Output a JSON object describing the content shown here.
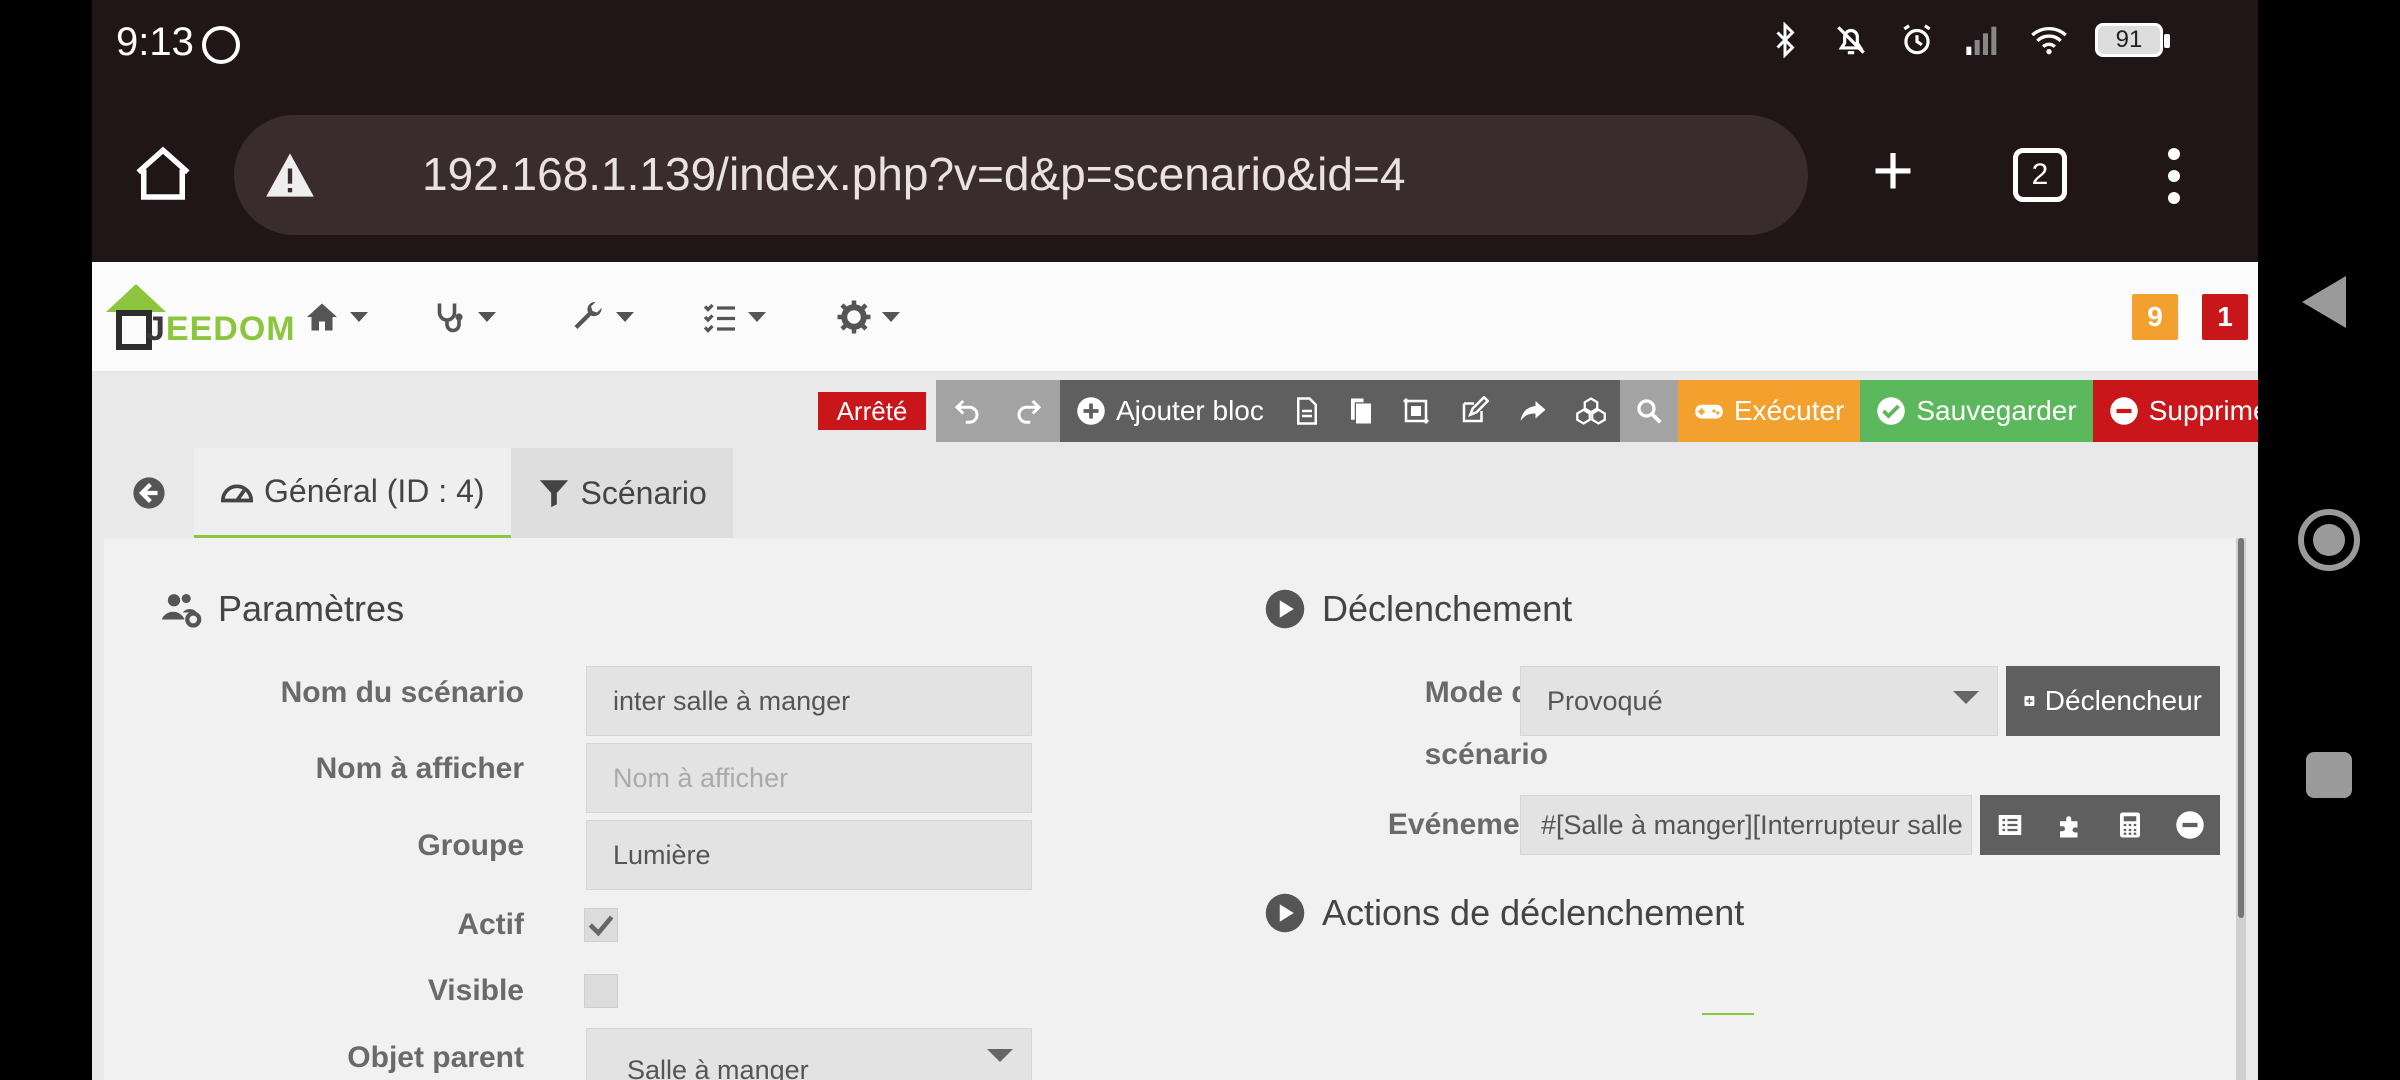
{
  "status_bar": {
    "time": "9:13",
    "battery": "91"
  },
  "browser": {
    "url": "192.168.1.139/index.php?v=d&p=scenario&id=4",
    "tab_count": "2"
  },
  "notifications": {
    "orange_count": "9",
    "red_count": "1"
  },
  "colors": {
    "accent_green": "#8cc63f",
    "danger_red": "#c9161b",
    "warning_orange": "#f2a12e",
    "success_green": "#5cb85c"
  },
  "toolbar": {
    "state": "Arrêté",
    "add_block": "Ajouter bloc",
    "execute": "Exécuter",
    "save": "Sauvegarder",
    "delete": "Supprimer"
  },
  "tabs": {
    "general": "Général (ID : 4)",
    "scenario": "Scénario"
  },
  "params": {
    "title": "Paramètres",
    "name_label": "Nom du scénario",
    "name_value": "inter salle à manger",
    "display_label": "Nom à afficher",
    "display_placeholder": "Nom à afficher",
    "group_label": "Groupe",
    "group_value": "Lumière",
    "active_label": "Actif",
    "visible_label": "Visible",
    "parent_label": "Objet parent",
    "parent_value": "Salle à manger"
  },
  "trigger": {
    "title": "Déclenchement",
    "mode_label_1": "Mode du",
    "mode_label_2": "scénario",
    "mode_value": "Provoqué",
    "trigger_button": "Déclencheur",
    "event_label": "Evénement",
    "event_value": "#[Salle à manger][Interrupteur salle",
    "actions_title": "Actions de déclenchement"
  }
}
